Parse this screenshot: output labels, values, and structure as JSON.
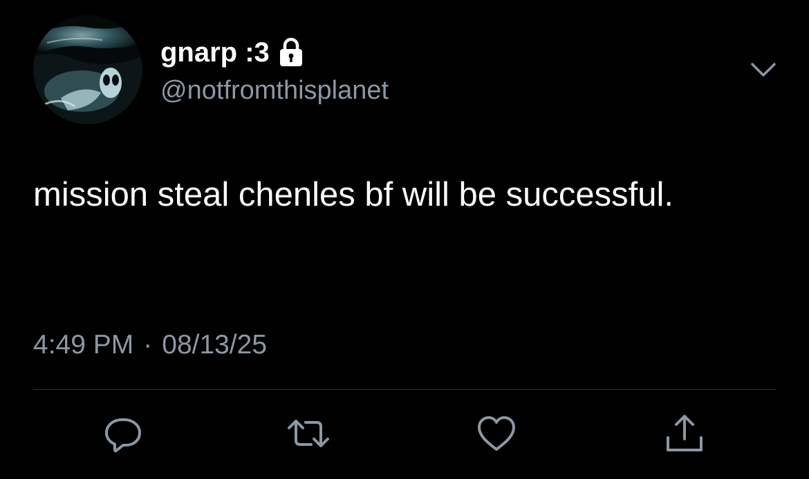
{
  "user": {
    "display_name": "gnarp :3",
    "handle": "@notfromthisplanet",
    "protected_icon": "lock-icon",
    "avatar": "alien-ultrasound-avatar"
  },
  "tweet": {
    "text": "mission steal chenles bf will be successful.",
    "time": "4:49 PM",
    "separator": "·",
    "date": "08/13/25"
  },
  "menu": {
    "icon": "chevron-down-icon"
  },
  "actions": [
    {
      "name": "reply",
      "icon": "reply-icon"
    },
    {
      "name": "retweet",
      "icon": "retweet-icon"
    },
    {
      "name": "like",
      "icon": "heart-icon"
    },
    {
      "name": "share",
      "icon": "share-icon"
    }
  ],
  "colors": {
    "background": "#000000",
    "primary_text": "#ffffff",
    "secondary_text": "#8b98a5",
    "icon": "#8b98a5",
    "divider": "#2f3336"
  }
}
